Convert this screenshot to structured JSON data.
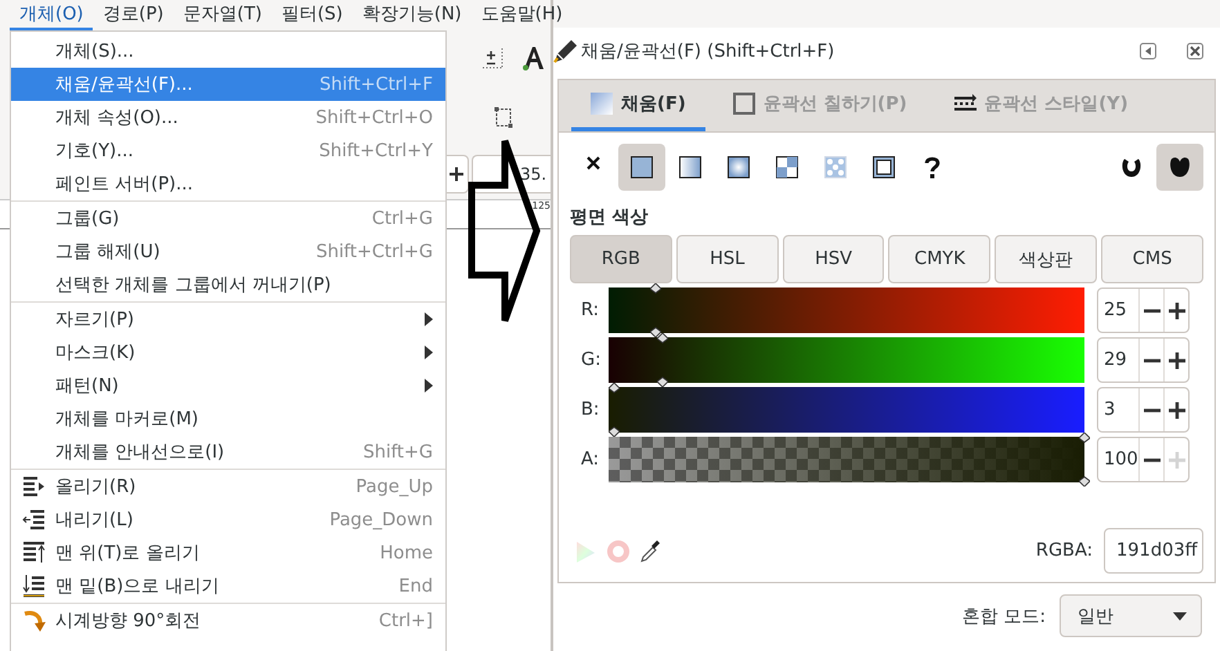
{
  "menubar": [
    {
      "label": "개체(O)",
      "selected": true
    },
    {
      "label": "경로(P)",
      "selected": false
    },
    {
      "label": "문자열(T)",
      "selected": false
    },
    {
      "label": "필터(S)",
      "selected": false
    },
    {
      "label": "확장기능(N)",
      "selected": false
    },
    {
      "label": "도움말(H)",
      "selected": false
    }
  ],
  "background": {
    "spin_value": "35.",
    "ruler_labels": [
      "125"
    ]
  },
  "menu": {
    "sections": [
      [
        {
          "kind": "plain",
          "label": "개체(S)...",
          "selected": false
        },
        {
          "kind": "plain",
          "label": "채움/윤곽선(F)...",
          "shortcut": "Shift+Ctrl+F",
          "selected": true
        },
        {
          "kind": "plain",
          "label": "개체 속성(O)...",
          "shortcut": "Shift+Ctrl+O",
          "selected": false
        },
        {
          "kind": "plain",
          "label": "기호(Y)...",
          "shortcut": "Shift+Ctrl+Y",
          "selected": false
        },
        {
          "kind": "plain",
          "label": "페인트 서버(P)...",
          "selected": false
        }
      ],
      [
        {
          "kind": "plain",
          "label": "그룹(G)",
          "shortcut": "Ctrl+G",
          "selected": false
        },
        {
          "kind": "plain",
          "label": "그룹 해제(U)",
          "shortcut": "Shift+Ctrl+G",
          "selected": false
        },
        {
          "kind": "plain",
          "label": "선택한 개체를 그룹에서 꺼내기(P)",
          "selected": false
        }
      ],
      [
        {
          "kind": "submenu",
          "label": "자르기(P)",
          "selected": false
        },
        {
          "kind": "submenu",
          "label": "마스크(K)",
          "selected": false
        },
        {
          "kind": "submenu",
          "label": "패턴(N)",
          "selected": false
        },
        {
          "kind": "plain",
          "label": "개체를 마커로(M)",
          "selected": false
        },
        {
          "kind": "plain",
          "label": "개체를 안내선으로(I)",
          "shortcut": "Shift+G",
          "selected": false
        }
      ],
      [
        {
          "kind": "raise",
          "label": "올리기(R)",
          "shortcut": "Page_Up",
          "selected": false
        },
        {
          "kind": "lower",
          "label": "내리기(L)",
          "shortcut": "Page_Down",
          "selected": false
        },
        {
          "kind": "top",
          "label": "맨 위(T)로 올리기",
          "shortcut": "Home",
          "selected": false
        },
        {
          "kind": "bottom",
          "label": "맨 밑(B)으로 내리기",
          "shortcut": "End",
          "selected": false
        }
      ],
      [
        {
          "kind": "rotate_cw",
          "label": "시계방향 90°회전",
          "shortcut": "Ctrl+]",
          "selected": false
        }
      ]
    ]
  },
  "dialog": {
    "title": "채움/윤곽선(F) (Shift+Ctrl+F)",
    "tabs": [
      {
        "kind": "fill",
        "label": "채움(F)",
        "selected": true
      },
      {
        "kind": "stroke",
        "label": "윤곽선 칠하기(P)",
        "selected": false
      },
      {
        "kind": "style",
        "label": "윤곽선 스타일(Y)",
        "selected": false
      }
    ],
    "fill_types": [
      {
        "kind": "none",
        "selected": false
      },
      {
        "kind": "flat",
        "selected": true
      },
      {
        "kind": "linear",
        "selected": false
      },
      {
        "kind": "radial",
        "selected": false
      },
      {
        "kind": "mesh",
        "selected": false
      },
      {
        "kind": "pattern",
        "selected": false
      },
      {
        "kind": "swatch",
        "selected": false
      },
      {
        "kind": "unset",
        "selected": false
      }
    ],
    "fill_rules": [
      {
        "kind": "evenodd",
        "selected": false
      },
      {
        "kind": "nonzero",
        "selected": true
      }
    ],
    "section_label": "평면 색상",
    "color_modes": [
      {
        "label": "RGB",
        "selected": true
      },
      {
        "label": "HSL",
        "selected": false
      },
      {
        "label": "HSV",
        "selected": false
      },
      {
        "label": "CMYK",
        "selected": false
      },
      {
        "label": "색상판",
        "selected": false
      },
      {
        "label": "CMS",
        "selected": false
      }
    ],
    "channels": [
      {
        "label": "R:",
        "value": "25",
        "level": 0.098,
        "plus_disabled": false
      },
      {
        "label": "G:",
        "value": "29",
        "level": 0.114,
        "plus_disabled": false
      },
      {
        "label": "B:",
        "value": "3",
        "level": 0.012,
        "plus_disabled": false
      },
      {
        "label": "A:",
        "value": "100",
        "level": 1,
        "plus_disabled": true
      }
    ],
    "rgba": {
      "label": "RGBA:",
      "value": "191d03ff"
    },
    "blend": {
      "label": "혼합 모드:",
      "value": "일반"
    }
  }
}
